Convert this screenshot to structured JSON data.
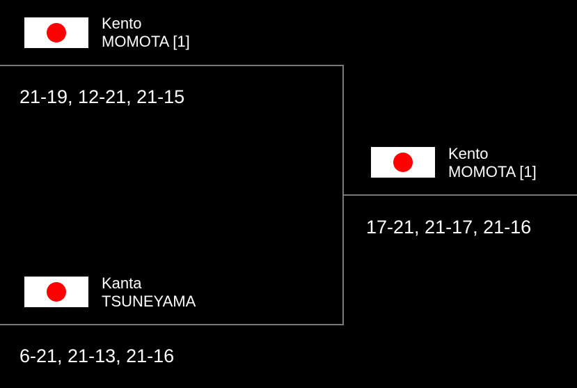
{
  "bracket": {
    "match1": {
      "top_player": {
        "first": "Kento",
        "last": "MOMOTA [1]",
        "flag_icon": "japan-flag-icon"
      },
      "bottom_player": {
        "first": "Kanta",
        "last": "TSUNEYAMA",
        "flag_icon": "japan-flag-icon"
      },
      "top_score": "21-19, 12-21, 21-15",
      "bottom_score": "6-21, 21-13, 21-16"
    },
    "match2": {
      "winner": {
        "first": "Kento",
        "last": "MOMOTA [1]",
        "flag_icon": "japan-flag-icon"
      },
      "score": "17-21, 21-17, 21-16"
    }
  },
  "colors": {
    "background": "#000000",
    "text": "#ffffff",
    "bracket_line": "#7a7a7a",
    "flag_white": "#ffffff",
    "flag_red": "#ff0000"
  }
}
